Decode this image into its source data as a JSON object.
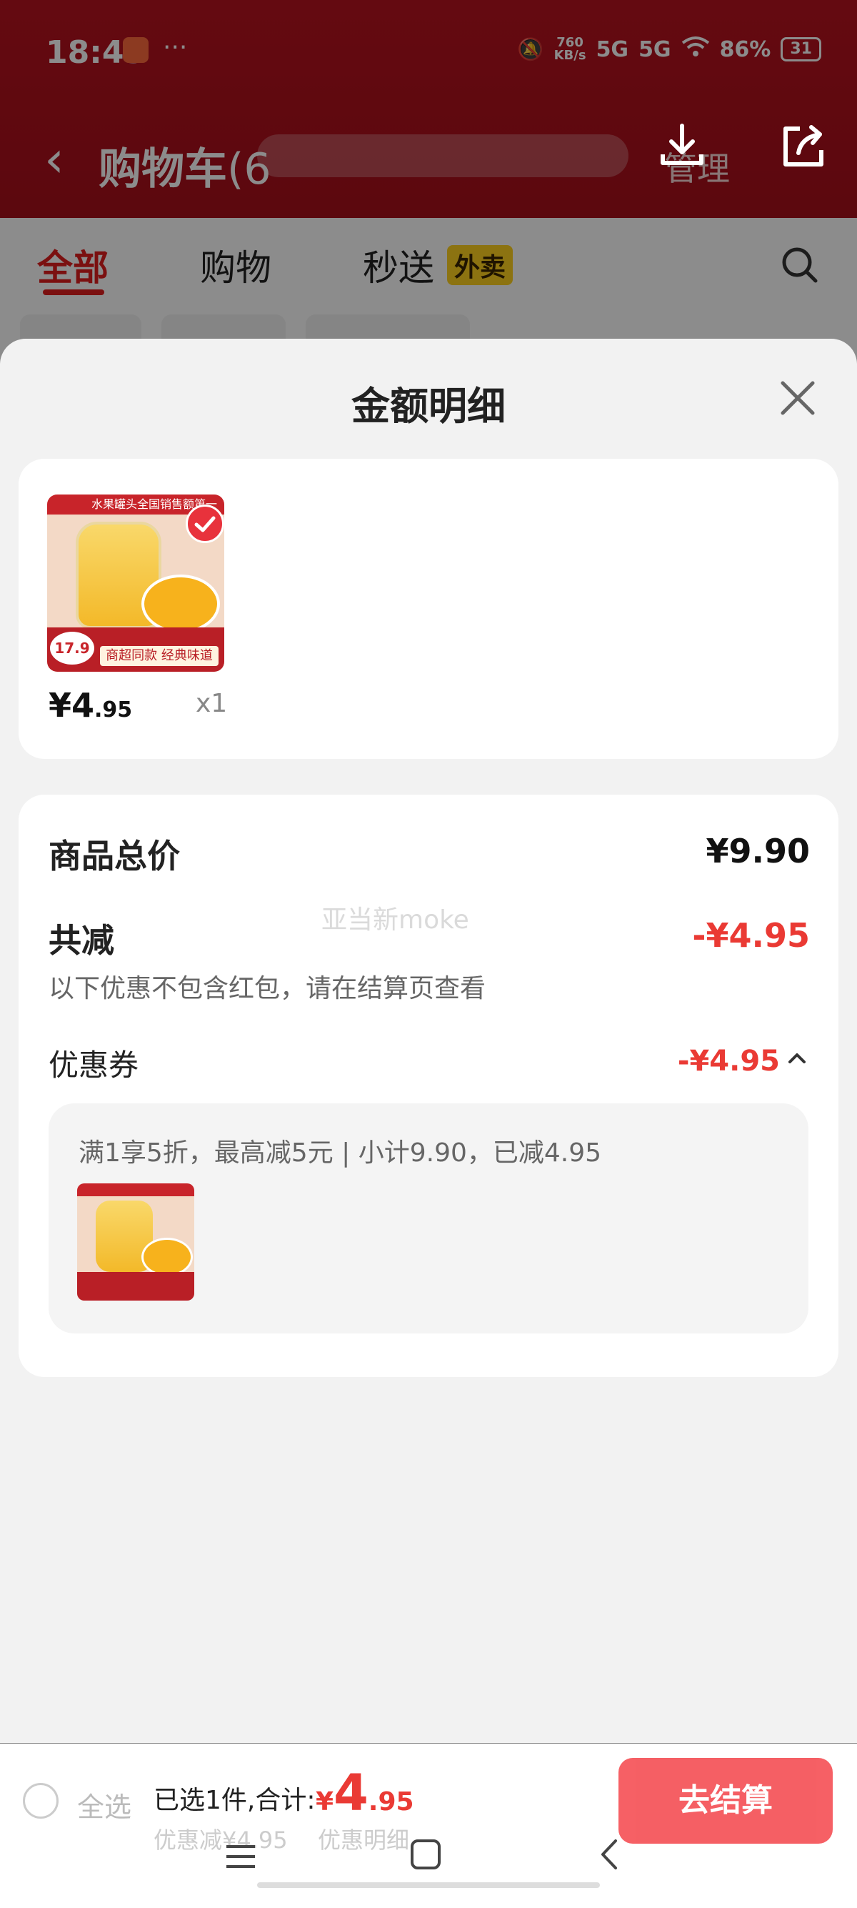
{
  "status_bar": {
    "time": "18:43",
    "speed_value": "760",
    "speed_unit": "KB/s",
    "net_1": "5G",
    "net_2": "5G",
    "battery_percent": "86%",
    "battery_icon_text": "31",
    "more": "···"
  },
  "header": {
    "title": "购物车",
    "count_prefix": "(6",
    "manage_label": "管理"
  },
  "tabs": [
    {
      "label": "全部"
    },
    {
      "label": "购物"
    },
    {
      "label": "秒送"
    }
  ],
  "takeout_badge": "外卖",
  "sheet": {
    "title": "金额明细",
    "item": {
      "banner": "水果罐头全国销售额第一",
      "thumb_price": "17.9",
      "thumb_slogan": "商超同款 经典味道",
      "price_symbol": "¥",
      "price_int": "4",
      "price_dec": ".95",
      "qty": "x1"
    },
    "summary": {
      "total_label": "商品总价",
      "total_value": "¥9.90",
      "discount_label": "共减",
      "discount_value": "-¥4.95",
      "discount_note": "以下优惠不包含红包，请在结算页查看",
      "coupon_label": "优惠券",
      "coupon_value": "-¥4.95",
      "coupon_desc": "满1享5折，最高减5元 | 小计9.90，已减4.95"
    },
    "watermark": "亚当新moke"
  },
  "bottom_bar": {
    "select_all": "全选",
    "selected_summary": "已选1件,合计:",
    "total_symbol": "¥",
    "total_int": "4",
    "total_dec": ".95",
    "discount_hint": "优惠减¥4.95",
    "detail_link": "优惠明细",
    "checkout_label": "去结算"
  },
  "colors": {
    "header_red": "#b7131f",
    "accent_red": "#ea3a34",
    "tab_active": "#e01e1e",
    "checkout_button": "#f4444a",
    "takeout_yellow": "#ffd21f"
  },
  "icons": [
    "back-icon",
    "download-icon",
    "share-icon",
    "search-icon",
    "close-icon",
    "check-icon",
    "chevron-up-icon",
    "menu-icon",
    "home-icon",
    "nav-back-icon"
  ]
}
